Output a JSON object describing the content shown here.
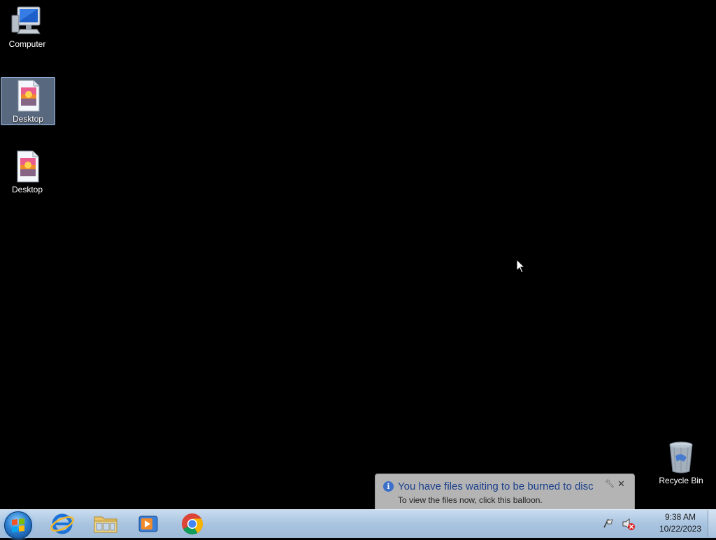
{
  "desktop": {
    "icons": [
      {
        "label": "Computer",
        "selected": false,
        "icon": "computer-icon"
      },
      {
        "label": "Desktop",
        "selected": true,
        "icon": "image-file-icon"
      },
      {
        "label": "Desktop",
        "selected": false,
        "icon": "image-file-icon"
      },
      {
        "label": "Recycle Bin",
        "selected": false,
        "icon": "recycle-bin-icon"
      }
    ]
  },
  "balloon": {
    "title": "You have files waiting to be burned to disc",
    "text": "To view the files now, click this balloon.",
    "icon": "info-icon"
  },
  "taskbar": {
    "pinned": [
      {
        "name": "Internet Explorer",
        "icon": "internet-explorer-icon"
      },
      {
        "name": "Windows Explorer",
        "icon": "folder-icon"
      },
      {
        "name": "Windows Media Player",
        "icon": "media-player-icon"
      },
      {
        "name": "Google Chrome",
        "icon": "chrome-icon"
      }
    ],
    "clock": {
      "time": "9:38 AM",
      "date": "10/22/2023"
    }
  },
  "colors": {
    "desktop_bg": "#000000",
    "taskbar": "#a9c4e0",
    "balloon_bg": "#b4b4b4",
    "balloon_title": "#1b3f8b"
  }
}
